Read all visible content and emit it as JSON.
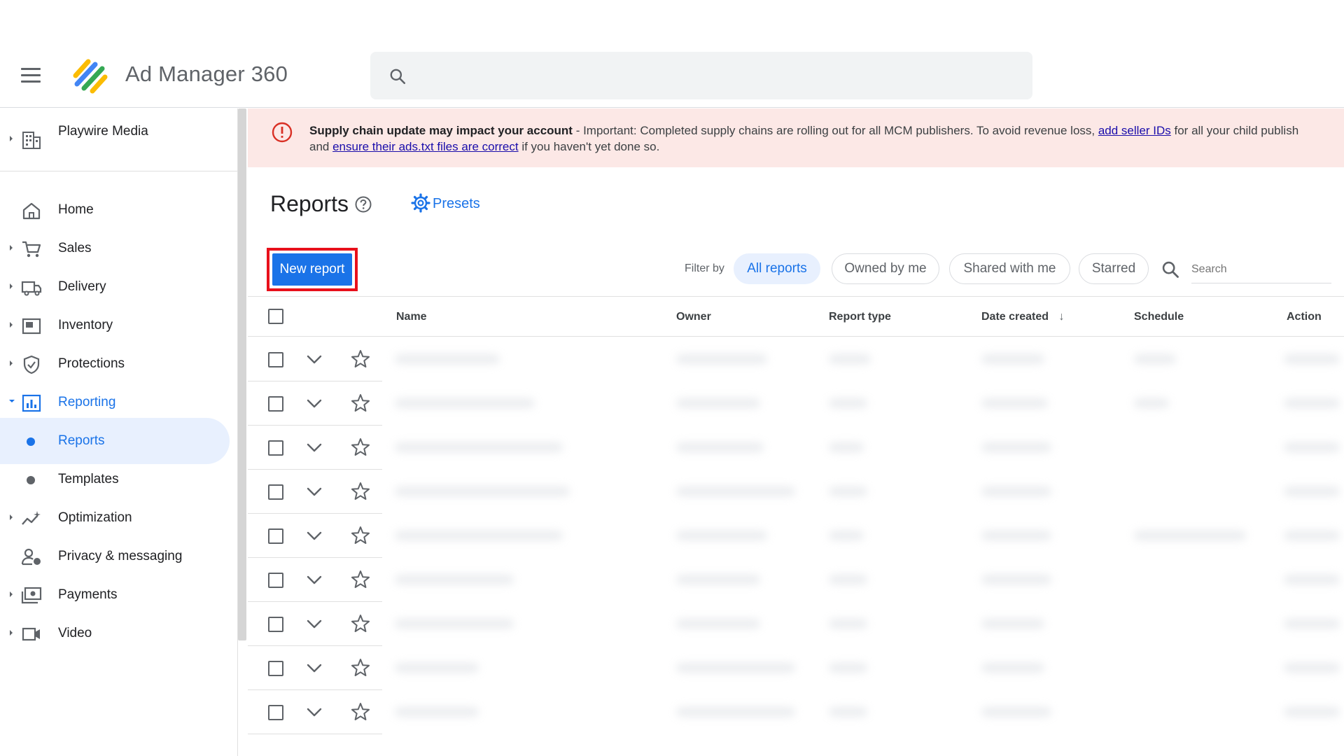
{
  "app": {
    "title": "Ad Manager 360"
  },
  "search": {
    "placeholder": ""
  },
  "sidebar": {
    "org": "Playwire Media",
    "items": [
      {
        "label": "Home"
      },
      {
        "label": "Sales"
      },
      {
        "label": "Delivery"
      },
      {
        "label": "Inventory"
      },
      {
        "label": "Protections"
      },
      {
        "label": "Reporting"
      },
      {
        "label": "Reports"
      },
      {
        "label": "Templates"
      },
      {
        "label": "Optimization"
      },
      {
        "label": "Privacy & messaging"
      },
      {
        "label": "Payments"
      },
      {
        "label": "Video"
      }
    ]
  },
  "alert": {
    "title": "Supply chain update may impact your account",
    "text1": " - Important: Completed supply chains are rolling out for all MCM publishers. To avoid revenue loss, ",
    "link1": "add seller IDs",
    "text2": " for all your child publish",
    "text3": "and ",
    "link2": "ensure their ads.txt files are correct",
    "text4": " if you haven't yet done so."
  },
  "page": {
    "title": "Reports",
    "presets": "Presets",
    "new_report": "New report"
  },
  "filters": {
    "label": "Filter by",
    "chips": [
      "All reports",
      "Owned by me",
      "Shared with me",
      "Starred"
    ],
    "search_placeholder": "Search"
  },
  "table": {
    "columns": [
      "Name",
      "Owner",
      "Report type",
      "Date created",
      "Schedule",
      "Action"
    ],
    "sort_indicator": "↓"
  },
  "colors": {
    "accent": "#1a73e8",
    "alert_bg": "#fce8e6",
    "highlight_border": "#e8101b"
  }
}
